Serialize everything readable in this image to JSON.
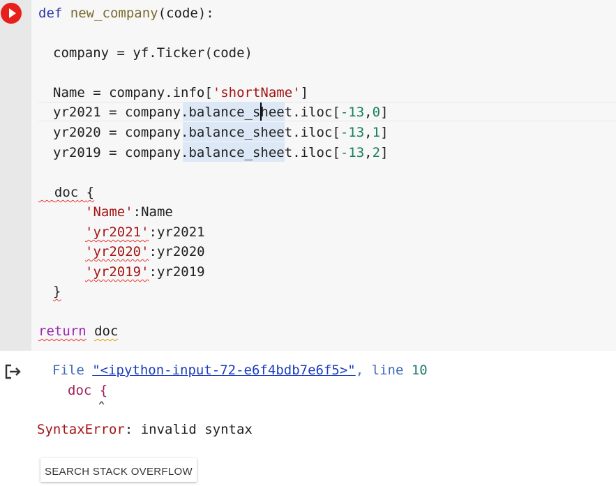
{
  "code_cell": {
    "line1": {
      "def": "def",
      "fname": "new_company",
      "params": "(code):"
    },
    "line2": {
      "text": "company = yf.Ticker(code)"
    },
    "line3": {
      "a": "Name = company.info[",
      "s": "'shortName'",
      "b": "]"
    },
    "line4": {
      "lhs": "yr2021 = company.",
      "attr": "balance_sheet",
      "mid": ".iloc[",
      "n1": "-13",
      "comma": ",",
      "n2": "0",
      "end": "]"
    },
    "line5": {
      "lhs": "yr2020 = company.",
      "attr": "balance_sheet",
      "mid": ".iloc[",
      "n1": "-13",
      "comma": ",",
      "n2": "1",
      "end": "]"
    },
    "line6": {
      "lhs": "yr2019 = company.",
      "attr": "balance_sheet",
      "mid": ".iloc[",
      "n1": "-13",
      "comma": ",",
      "n2": "2",
      "end": "]"
    },
    "line7": {
      "name": "doc",
      "brace": "{"
    },
    "line8": {
      "key": "'Name'",
      "rest": ":Name"
    },
    "line9": {
      "key": "'yr2021'",
      "rest": ":yr2021"
    },
    "line10": {
      "key": "'yr2020'",
      "rest": ":yr2020"
    },
    "line11": {
      "key": "'yr2019'",
      "rest": ":yr2019"
    },
    "line12": {
      "brace": "}"
    },
    "line13": {
      "kw": "return",
      "var": "doc"
    }
  },
  "output": {
    "file_word": "File",
    "file_link": "\"<ipython-input-72-e6f4bdb7e6f5>\"",
    "comma": ",",
    "line_word": "line",
    "line_num": "10",
    "code_line": "doc {",
    "caret": "^",
    "error_type": "SyntaxError",
    "error_msg": ": invalid syntax"
  },
  "search_button": {
    "label": "SEARCH STACK OVERFLOW"
  },
  "colors": {
    "run_button": "#e8201b",
    "keyword": "#2d38a8",
    "string": "#a31515",
    "number": "#15815a",
    "return": "#9c27b0",
    "link": "#1a3cbf"
  }
}
